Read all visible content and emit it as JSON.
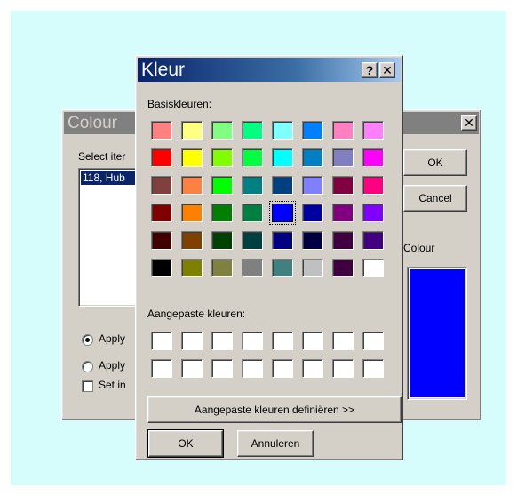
{
  "back_dialog": {
    "title": "Colour",
    "close_label": "✕",
    "select_label": "Select iter",
    "list_items": [
      "118, Hub"
    ],
    "ok_label": "OK",
    "cancel_label": "Cancel",
    "colour_label": "Colour",
    "preview_color": "#0000ff",
    "option1_label": "Apply",
    "option2_label": "Apply",
    "option3_label": "Set in"
  },
  "color_dialog": {
    "title": "Kleur",
    "help_label": "?",
    "close_label": "✕",
    "basic_label": "Basiskleuren:",
    "basic_colors": [
      [
        "#ff8080",
        "#ffff80",
        "#80ff80",
        "#00ff80",
        "#80ffff",
        "#0080ff",
        "#ff80c0",
        "#ff80ff"
      ],
      [
        "#ff0000",
        "#ffff00",
        "#80ff00",
        "#00ff40",
        "#00ffff",
        "#0080c0",
        "#8080c0",
        "#ff00ff"
      ],
      [
        "#804040",
        "#ff8040",
        "#00ff00",
        "#008080",
        "#004080",
        "#8080ff",
        "#800040",
        "#ff0080"
      ],
      [
        "#800000",
        "#ff8000",
        "#008000",
        "#008040",
        "#0000ff",
        "#0000a0",
        "#800080",
        "#8000ff"
      ],
      [
        "#400000",
        "#804000",
        "#004000",
        "#004040",
        "#000080",
        "#000040",
        "#400040",
        "#400080"
      ],
      [
        "#000000",
        "#808000",
        "#808040",
        "#808080",
        "#408080",
        "#c0c0c0",
        "#400040",
        "#ffffff"
      ]
    ],
    "selected_color": "#0000ff",
    "custom_label": "Aangepaste kleuren:",
    "custom_colors": [
      [
        "#ffffff",
        "#ffffff",
        "#ffffff",
        "#ffffff",
        "#ffffff",
        "#ffffff",
        "#ffffff",
        "#ffffff"
      ],
      [
        "#ffffff",
        "#ffffff",
        "#ffffff",
        "#ffffff",
        "#ffffff",
        "#ffffff",
        "#ffffff",
        "#ffffff"
      ]
    ],
    "define_label": "Aangepaste kleuren definiëren >>",
    "ok_label": "OK",
    "cancel_label": "Annuleren"
  }
}
